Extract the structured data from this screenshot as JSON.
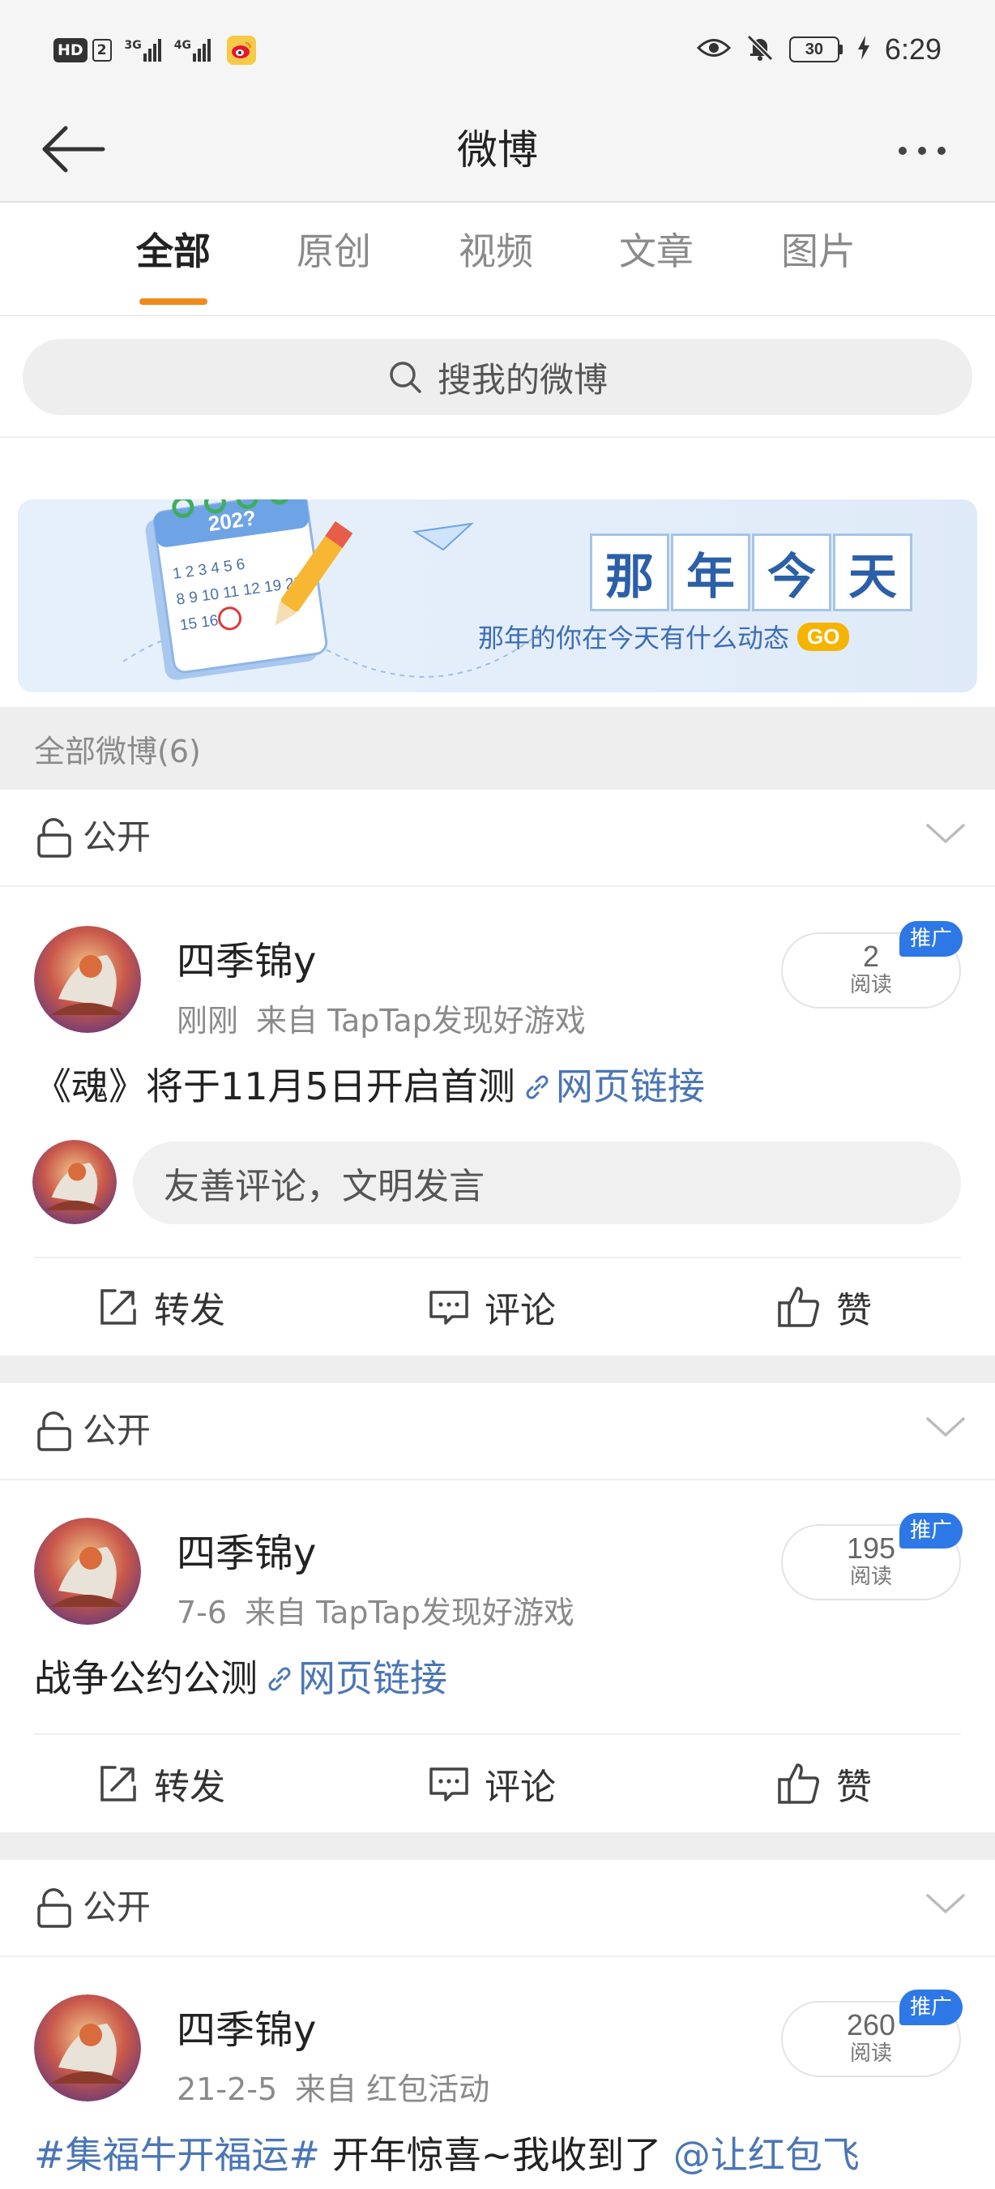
{
  "status_bar": {
    "hd": "HD",
    "sim": "2",
    "net1": "3G",
    "net2": "4G",
    "battery": "30",
    "time": "6:29"
  },
  "nav": {
    "title": "微博"
  },
  "tabs": [
    {
      "label": "全部",
      "active": true
    },
    {
      "label": "原创",
      "active": false
    },
    {
      "label": "视频",
      "active": false
    },
    {
      "label": "文章",
      "active": false
    },
    {
      "label": "图片",
      "active": false
    }
  ],
  "search": {
    "placeholder": "搜我的微博"
  },
  "banner": {
    "calendar_year": "202?",
    "title_chars": [
      "那",
      "年",
      "今",
      "天"
    ],
    "subtitle": "那年的你在今天有什么动态",
    "go": "GO"
  },
  "section": {
    "title": "全部微博(6)"
  },
  "posts": [
    {
      "visibility": "公开",
      "author": "四季锦y",
      "time": "刚刚",
      "source": "来自 TapTap发现好游戏",
      "reads": "2",
      "reads_label": "阅读",
      "promo": "推广",
      "text": "《魂》将于11月5日开启首测",
      "link_text": "网页链接",
      "comment_placeholder": "友善评论，文明发言",
      "actions": {
        "repost": "转发",
        "comment": "评论",
        "like": "赞"
      }
    },
    {
      "visibility": "公开",
      "author": "四季锦y",
      "time": "7-6",
      "source": "来自 TapTap发现好游戏",
      "reads": "195",
      "reads_label": "阅读",
      "promo": "推广",
      "text": "战争公约公测",
      "link_text": "网页链接",
      "actions": {
        "repost": "转发",
        "comment": "评论",
        "like": "赞"
      }
    },
    {
      "visibility": "公开",
      "author": "四季锦y",
      "time": "21-2-5",
      "source": "来自 红包活动",
      "reads": "260",
      "reads_label": "阅读",
      "promo": "推广",
      "hashtag": "#集福牛开福运#",
      "text": " 开年惊喜~我收到了 ",
      "mention": "@让红包飞"
    }
  ],
  "colors": {
    "accent": "#f08a1c",
    "link": "#4a76b5",
    "promo": "#2d78e6",
    "banner_text": "#2b5fa8",
    "go": "#f5b400"
  }
}
